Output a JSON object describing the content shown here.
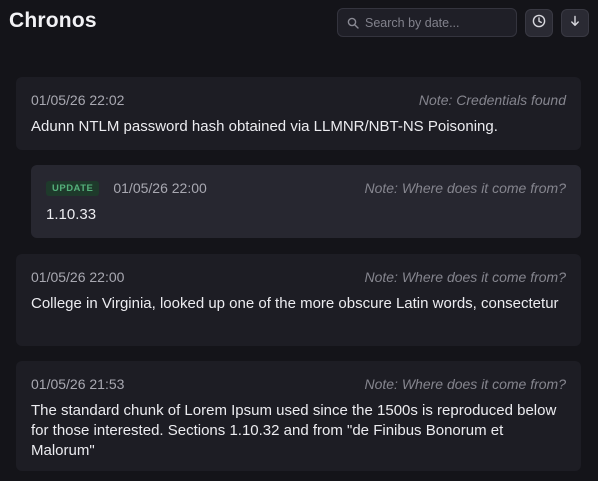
{
  "app": {
    "title": "Chronos"
  },
  "search": {
    "placeholder": "Search by date..."
  },
  "entries": [
    {
      "timestamp": "01/05/26 22:02",
      "note": "Note: Credentials found",
      "text": "Adunn NTLM password hash obtained via LLMNR/NBT-NS Poisoning."
    },
    {
      "badge": "UPDATE",
      "timestamp": "01/05/26 22:00",
      "note": "Note: Where does it come from?",
      "text": "1.10.33"
    },
    {
      "timestamp": "01/05/26 22:00",
      "note": "Note: Where does it come from?",
      "text": "College in Virginia, looked up one of the more obscure Latin words, consectetur"
    },
    {
      "timestamp": "01/05/26 21:53",
      "note": "Note: Where does it come from?",
      "text": "The standard chunk of Lorem Ipsum used since the 1500s is reproduced below for those interested. Sections 1.10.32 and from \"de Finibus Bonorum et Malorum\""
    }
  ]
}
